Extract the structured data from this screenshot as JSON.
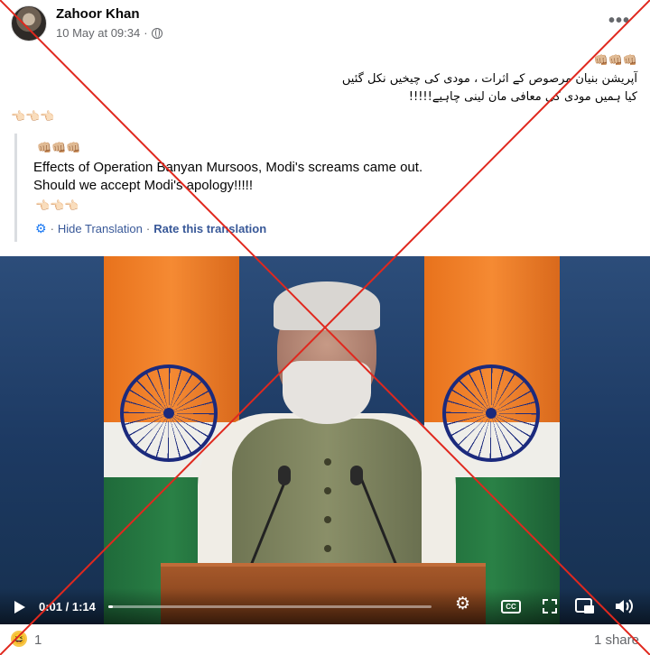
{
  "post": {
    "author": "Zahoor Khan",
    "timestamp": "10 May at 09:34",
    "separator": "·",
    "privacy_icon": "globe-icon",
    "more_label": "•••",
    "urdu_emoji": "👊🏼👊🏼👊🏼",
    "urdu_line1": "آپریشن بنیان مرصوص کے اثرات ، مودی کی چیخیں نکل گئیں",
    "urdu_line2": "کیا ہمیں مودی کی معافی مان لینی چاہیے!!!!!",
    "urdu_points": "👈🏻👈🏻👈🏻"
  },
  "translation": {
    "emoji_top": "👊🏼👊🏼👊🏼",
    "line1": "Effects of Operation Banyan Mursoos, Modi's screams came out.",
    "line2": "Should we accept Modi's apology!!!!!",
    "emoji_bottom": "👈🏻👈🏻👈🏻",
    "gear_icon": "⚙",
    "separator": "·",
    "hide_label": "Hide Translation",
    "rate_label": "Rate this translation"
  },
  "video": {
    "current_time": "0:01",
    "duration": "1:14",
    "time_separator": " / ",
    "progress": 0.013,
    "cc_label": "CC",
    "settings_icon": "gear-icon",
    "expand_icon": "expand-icon",
    "pip_icon": "picture-in-picture-icon",
    "volume_icon": "volume-icon"
  },
  "footer": {
    "reaction_emoji": "😆",
    "reaction_count": "1",
    "shares": "1 share"
  },
  "colors": {
    "cross_mark": "#e0281e",
    "link": "#385898",
    "muted": "#65676b"
  }
}
